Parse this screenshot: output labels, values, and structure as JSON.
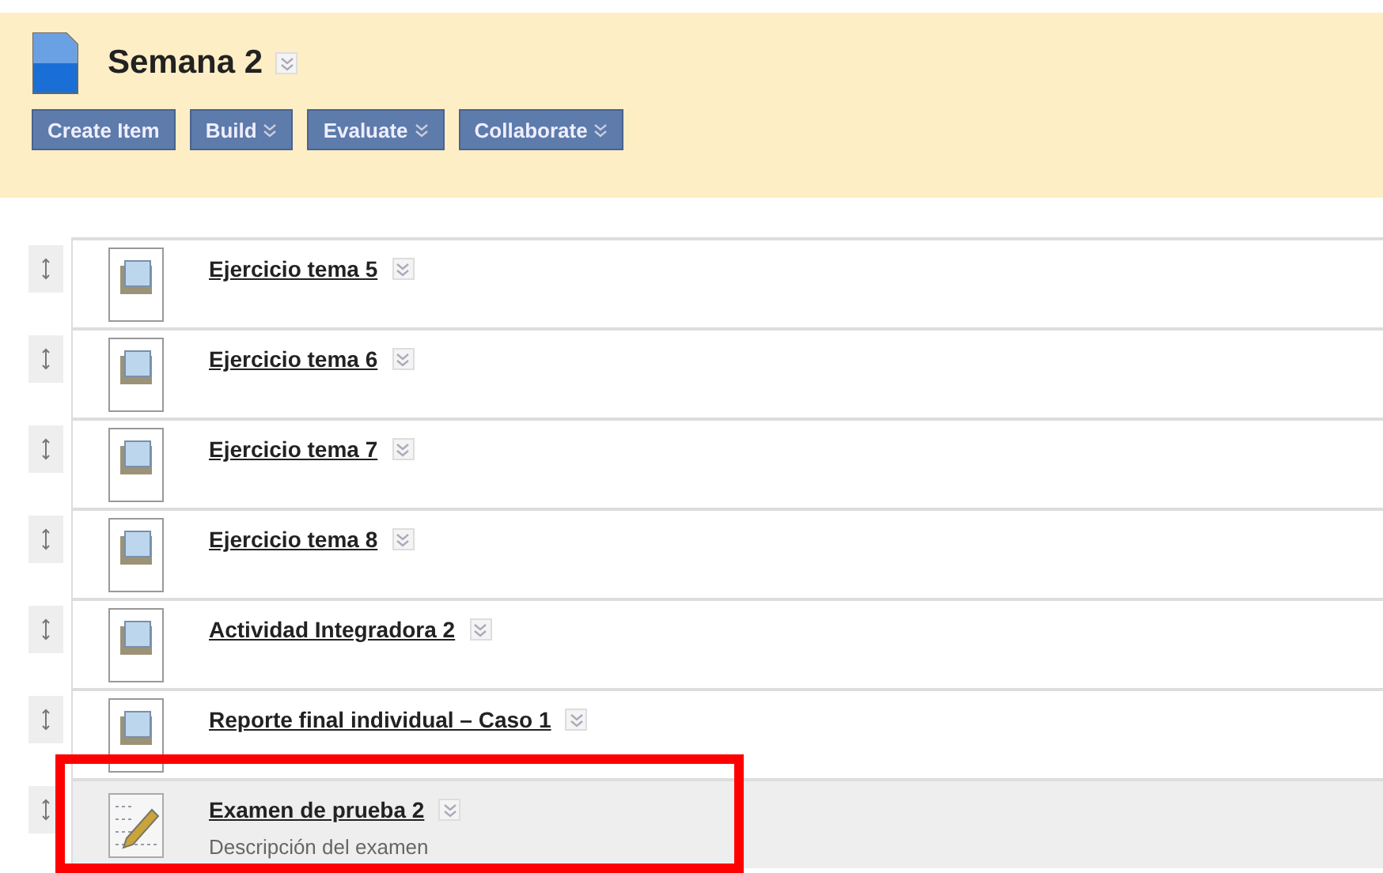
{
  "header": {
    "title": "Semana 2",
    "buttons": [
      {
        "label": "Create Item",
        "menu": false
      },
      {
        "label": "Build",
        "menu": true
      },
      {
        "label": "Evaluate",
        "menu": true
      },
      {
        "label": "Collaborate",
        "menu": true
      }
    ]
  },
  "items": [
    {
      "kind": "assignment",
      "title": "Ejercicio tema 5",
      "selected": false,
      "highlighted": false
    },
    {
      "kind": "assignment",
      "title": "Ejercicio tema 6",
      "selected": false,
      "highlighted": false
    },
    {
      "kind": "assignment",
      "title": "Ejercicio tema 7",
      "selected": false,
      "highlighted": false
    },
    {
      "kind": "assignment",
      "title": "Ejercicio tema 8",
      "selected": false,
      "highlighted": false
    },
    {
      "kind": "assignment",
      "title": "Actividad Integradora 2",
      "selected": false,
      "highlighted": false
    },
    {
      "kind": "assignment",
      "title": "Reporte final individual – Caso 1",
      "selected": false,
      "highlighted": false
    },
    {
      "kind": "test",
      "title": "Examen de prueba 2",
      "description": "Descripción del examen",
      "selected": true,
      "highlighted": true
    }
  ]
}
